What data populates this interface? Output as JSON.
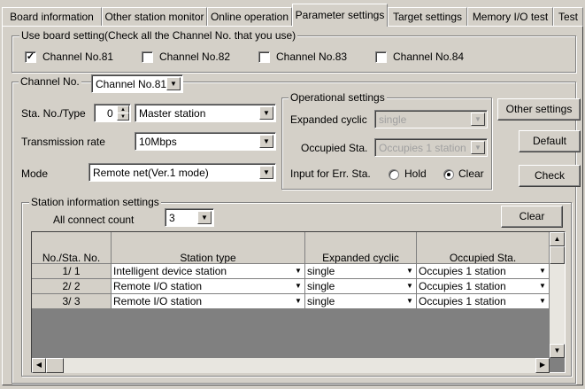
{
  "tabs": [
    {
      "label": "Board information"
    },
    {
      "label": "Other station monitor"
    },
    {
      "label": "Online operation"
    },
    {
      "label": "Parameter settings"
    },
    {
      "label": "Target settings"
    },
    {
      "label": "Memory I/O test"
    },
    {
      "label": "Test"
    }
  ],
  "board_setting": {
    "legend": "Use board setting(Check all the Channel No. that you use)",
    "channels": [
      {
        "label": "Channel No.81",
        "checked": "✓"
      },
      {
        "label": "Channel No.82",
        "checked": ""
      },
      {
        "label": "Channel No.83",
        "checked": ""
      },
      {
        "label": "Channel No.84",
        "checked": ""
      }
    ]
  },
  "channel": {
    "label": "Channel No.",
    "value": "Channel No.81"
  },
  "station": {
    "sta_no_label": "Sta. No./Type",
    "sta_no_value": "0",
    "type_value": "Master station",
    "rate_label": "Transmission rate",
    "rate_value": "10Mbps",
    "mode_label": "Mode",
    "mode_value": "Remote net(Ver.1 mode)"
  },
  "operational": {
    "legend": "Operational settings",
    "expanded_label": "Expanded cyclic",
    "expanded_value": "single",
    "occupied_label": "Occupied Sta.",
    "occupied_value": "Occupies 1 station",
    "input_err_label": "Input for Err. Sta.",
    "hold_label": "Hold",
    "clear_label": "Clear"
  },
  "buttons": {
    "other_settings": "Other settings",
    "default": "Default",
    "check": "Check",
    "clear": "Clear"
  },
  "station_info": {
    "legend": "Station information settings",
    "all_connect_label": "All connect count",
    "all_connect_value": "3",
    "headers": {
      "no": "No./Sta. No.",
      "type": "Station type",
      "expanded": "Expanded cyclic",
      "occupied": "Occupied Sta."
    },
    "rows": [
      {
        "no": "1/ 1",
        "type": "Intelligent device station",
        "expanded": "single",
        "occupied": "Occupies 1 station"
      },
      {
        "no": "2/ 2",
        "type": "Remote I/O station",
        "expanded": "single",
        "occupied": "Occupies 1 station"
      },
      {
        "no": "3/ 3",
        "type": "Remote I/O station",
        "expanded": "single",
        "occupied": "Occupies 1 station"
      }
    ]
  }
}
